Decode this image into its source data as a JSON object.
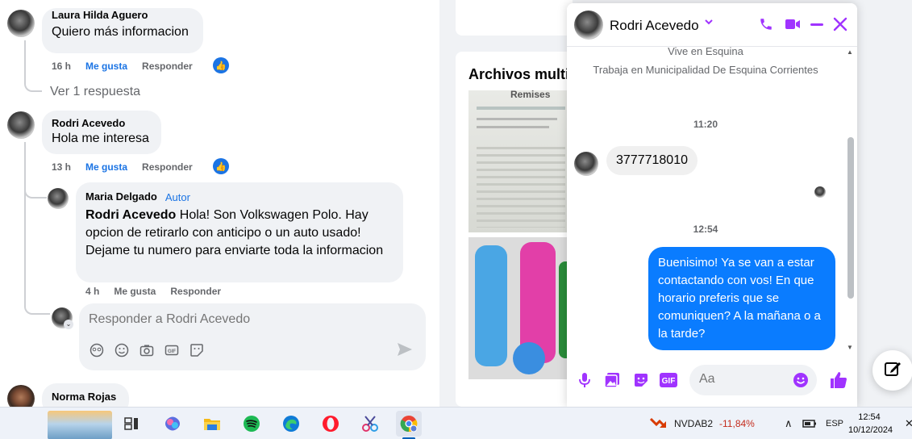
{
  "feed": {
    "comments": [
      {
        "name": "Laura Hilda Aguero",
        "text": "Quiero más informacion",
        "time": "16 h",
        "like": "Me gusta",
        "reply": "Responder"
      },
      {
        "name": "Rodri Acevedo",
        "text": "Hola me interesa",
        "time": "13 h",
        "like": "Me gusta",
        "reply": "Responder"
      },
      {
        "name": "Maria Delgado",
        "badge": "Autor",
        "mention": "Rodri Acevedo",
        "text": " Hola! Son Volkswagen Polo. Hay opcion de retirarlo con anticipo o un auto usado! Dejame tu numero para enviarte toda la informacion",
        "time": "4 h",
        "like": "Me gusta",
        "reply": "Responder"
      },
      {
        "name": "Norma Rojas"
      }
    ],
    "view_replies": "Ver 1 respuesta",
    "reply_placeholder": "Responder a Rodri Acevedo"
  },
  "media": {
    "title": "Archivos multi",
    "image1_text": "Remises"
  },
  "chat": {
    "name": "Rodri Acevedo",
    "info1": "Vive en Esquina",
    "info2": "Trabaja en Municipalidad De Esquina Corrientes",
    "time1": "11:20",
    "in_message": "3777718010",
    "time2": "12:54",
    "out_message": "Buenisimo! Ya se van a estar contactando con vos! En que horario preferis que se comuniquen? A la mañana o a la tarde?",
    "input_placeholder": "Aa",
    "accent": "#a033ff",
    "bubble_color": "#0a7cff"
  },
  "taskbar": {
    "stock_name": "NVDAB2",
    "stock_change": "-11,84%",
    "lang": "ESP",
    "time": "12:54",
    "date": "10/12/2024"
  }
}
